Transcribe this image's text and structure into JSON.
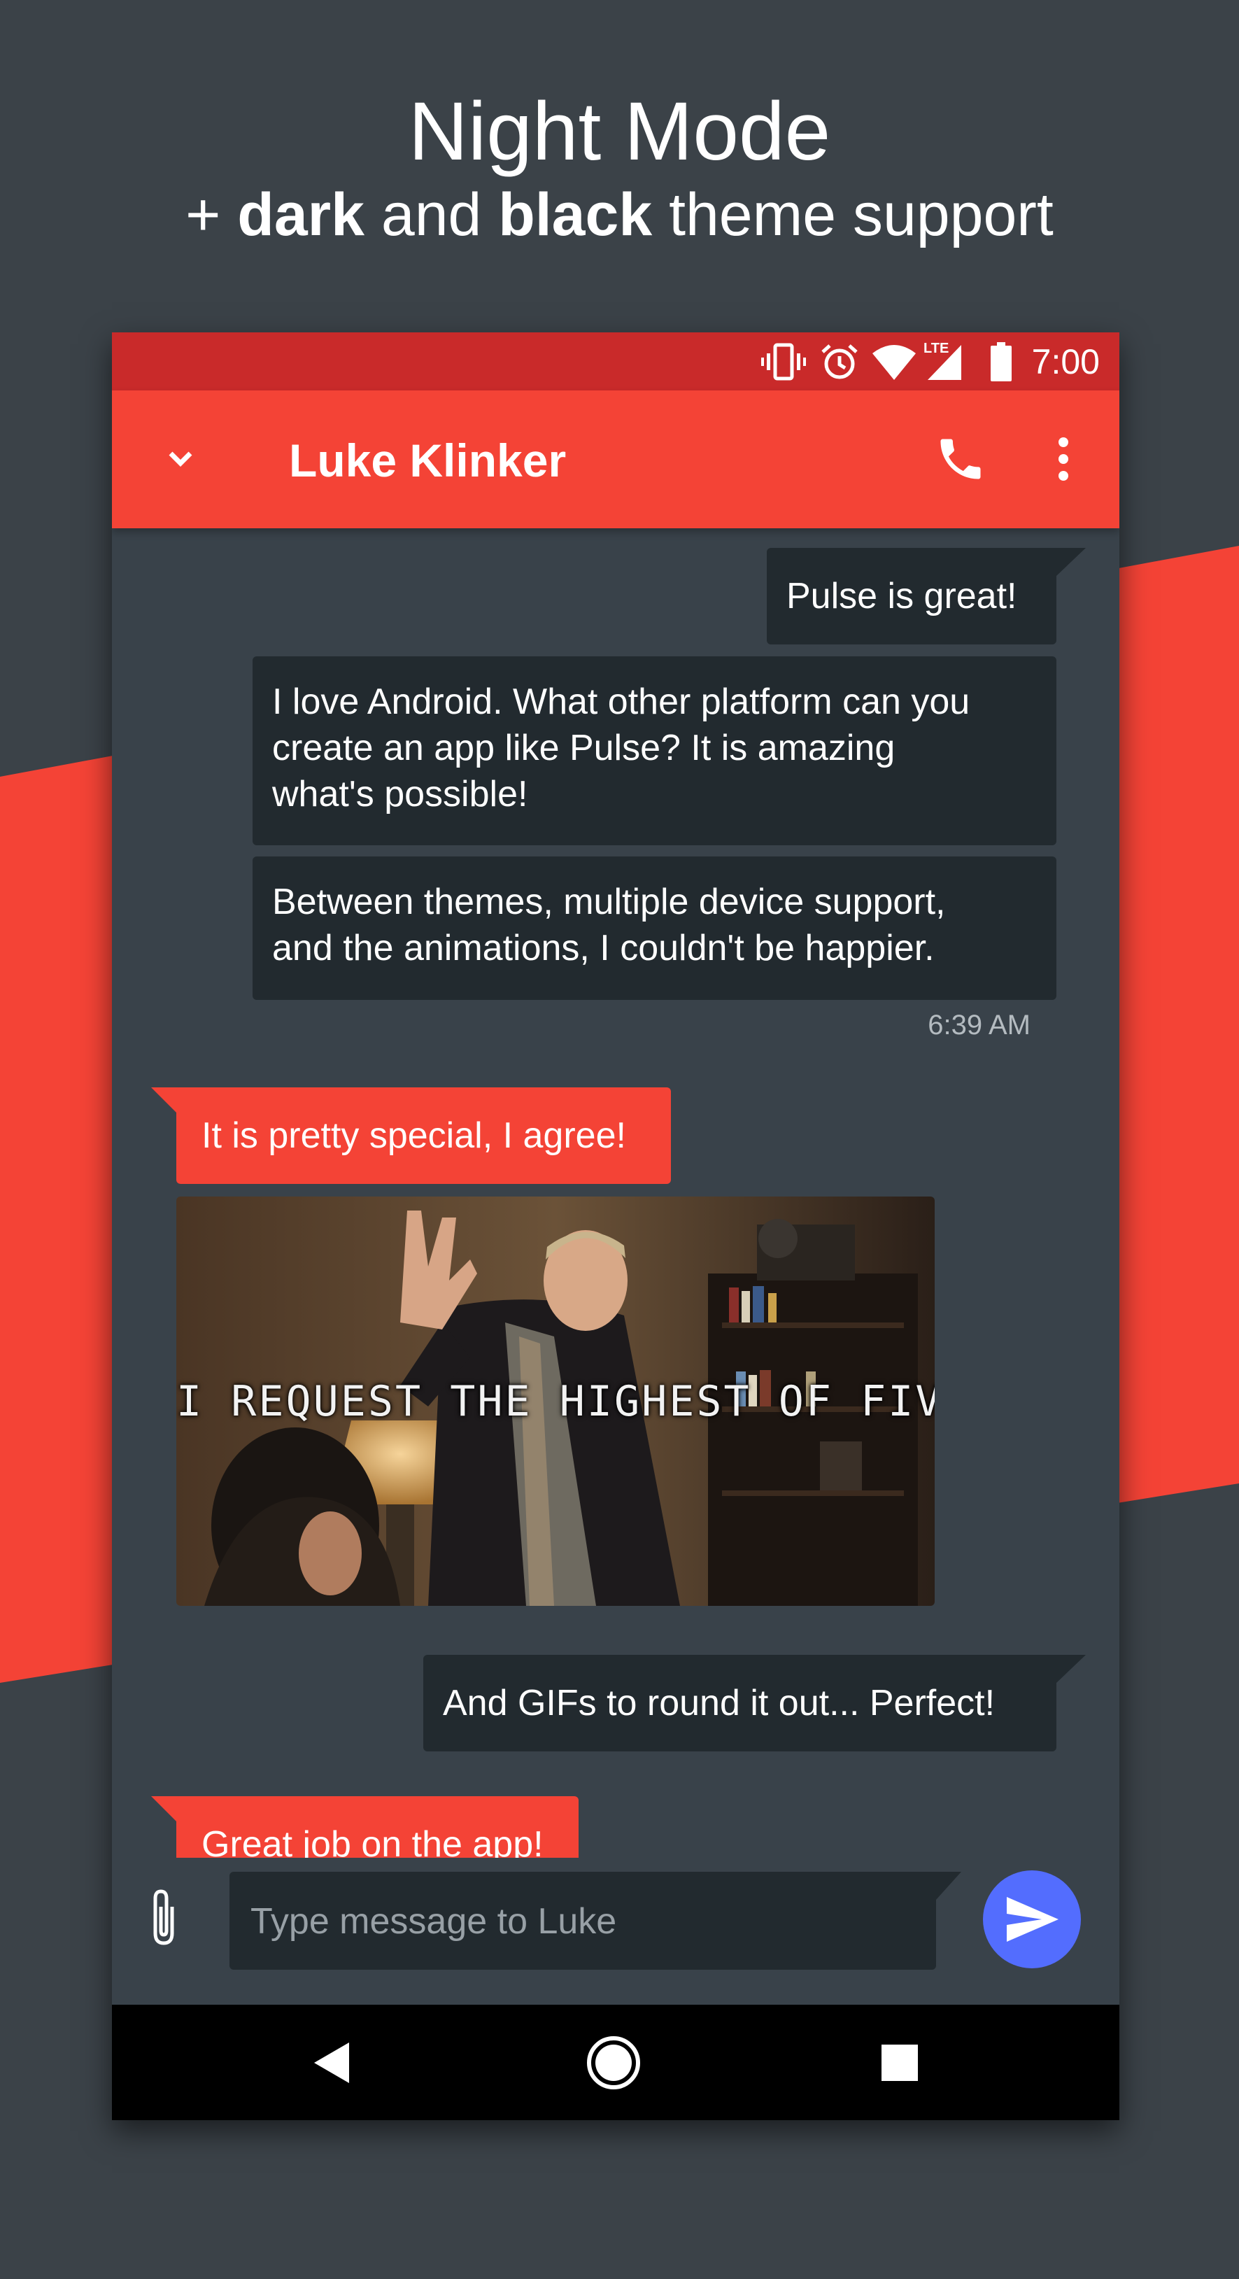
{
  "promo": {
    "headline": "Night Mode",
    "subline_prefix": "+ ",
    "subline_bold1": "dark",
    "subline_mid": " and ",
    "subline_bold2": "black",
    "subline_suffix": " theme support"
  },
  "status_bar": {
    "time": "7:00",
    "network_label": "LTE",
    "icons": [
      "vibrate-icon",
      "alarm-icon",
      "wifi-icon",
      "signal-icon",
      "battery-icon"
    ]
  },
  "app_bar": {
    "title": "Luke Klinker",
    "icons": [
      "chevron-down-icon",
      "phone-icon",
      "more-vert-icon"
    ]
  },
  "messages": [
    {
      "type": "sent",
      "text": "Pulse is great!"
    },
    {
      "type": "sent",
      "lines": [
        "I love Android. What other platform can you",
        "create an app like Pulse? It is amazing",
        "what's possible!"
      ]
    },
    {
      "type": "sent",
      "lines": [
        "Between themes, multiple device support,",
        "and the animations, I couldn't be happier."
      ]
    },
    {
      "type": "received",
      "text": "It is pretty special, I agree!"
    },
    {
      "type": "received-image",
      "caption": "I REQUEST THE HIGHEST OF FIVES"
    },
    {
      "type": "sent",
      "text": "And GIFs to round it out... Perfect!"
    },
    {
      "type": "received",
      "text": "Great job on the app!"
    }
  ],
  "timestamp": "6:39 AM",
  "composer": {
    "placeholder": "Type message to Luke",
    "icons": [
      "attach-icon",
      "send-icon"
    ]
  },
  "nav_bar": {
    "icons": [
      "back-icon",
      "home-icon",
      "recents-icon"
    ]
  },
  "colors": {
    "background": "#3b4248",
    "accent_red": "#f44336",
    "status_bar_red": "#c92a2a",
    "sent_bubble": "#222a2f",
    "send_button": "#536dfe"
  }
}
